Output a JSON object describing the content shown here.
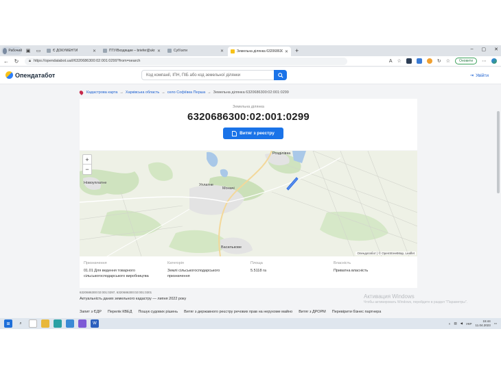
{
  "browser": {
    "profile_label": "Рабочий",
    "tabs": [
      {
        "title": "Є ДОКУМЕНТИ",
        "active": false
      },
      {
        "title": "ПТУ/Входящие – briefer@ukr.net",
        "active": false
      },
      {
        "title": "Суб'єкти",
        "active": false
      },
      {
        "title": "Земельна ділянка 6320686300:0",
        "active": true
      }
    ],
    "url": "https://opendatabot.ua/l/6320686300:02:001:0299?from=search",
    "sync_label": "Оновити"
  },
  "site": {
    "logo_text": "Опендатабот",
    "search_placeholder": "Код компанії, ІПН, ПІБ або код земельної ділянки",
    "login_label": "Увійти"
  },
  "breadcrumb": {
    "items": [
      "Кадастрова карта",
      "Харківська область",
      "село Софіївка Перша",
      "Земельна ділянка 6320686300:02:001:0299"
    ],
    "separator": "→"
  },
  "parcel": {
    "label": "Земельна ділянка",
    "number": "6320686300:02:001:0299",
    "extract_button": "Витяг з реєстру"
  },
  "map": {
    "zoom_in": "+",
    "zoom_out": "−",
    "places": [
      {
        "name": "Новоуплатне"
      },
      {
        "name": "Уплатне"
      },
      {
        "name": "Моначі"
      },
      {
        "name": "Василькове"
      },
      {
        "name": "Розділівка"
      }
    ],
    "attribution": "Опендатабот | © OpenStreetMap, Leaflet"
  },
  "details": {
    "purpose_label": "Призначення",
    "purpose_value": "01.01 Для ведення товарного сільськогосподарського виробництва",
    "category_label": "Категорія",
    "category_value": "Землі сільськогосподарського призначення",
    "area_label": "Площа",
    "area_value": "5.5118 га",
    "ownership_label": "Власність",
    "ownership_value": "Приватна власність"
  },
  "cadastral_numbers": "6320686300:02:001:0297, 6320686300:02:001:0301",
  "relevance": "Актуальність даних земельного кадастру — липня 2022 року",
  "activation": {
    "title": "Активация Windows",
    "subtitle": "Чтобы активировать Windows, перейдите в раздел \"Параметры\"."
  },
  "footer_links": [
    "Запит з ЄДР",
    "Перелік КВЕД",
    "Пошук судових рішень",
    "Витяг з державного реєстру речових прав на нерухоме майно",
    "Витяг з ДРОРМ",
    "Перевірити бізнес партнера"
  ],
  "taskbar": {
    "lang": "УКР",
    "time": "15:44",
    "date": "11.04.2023"
  },
  "colors": {
    "accent": "#1a73e8",
    "parcel": "#2f6fe0"
  }
}
